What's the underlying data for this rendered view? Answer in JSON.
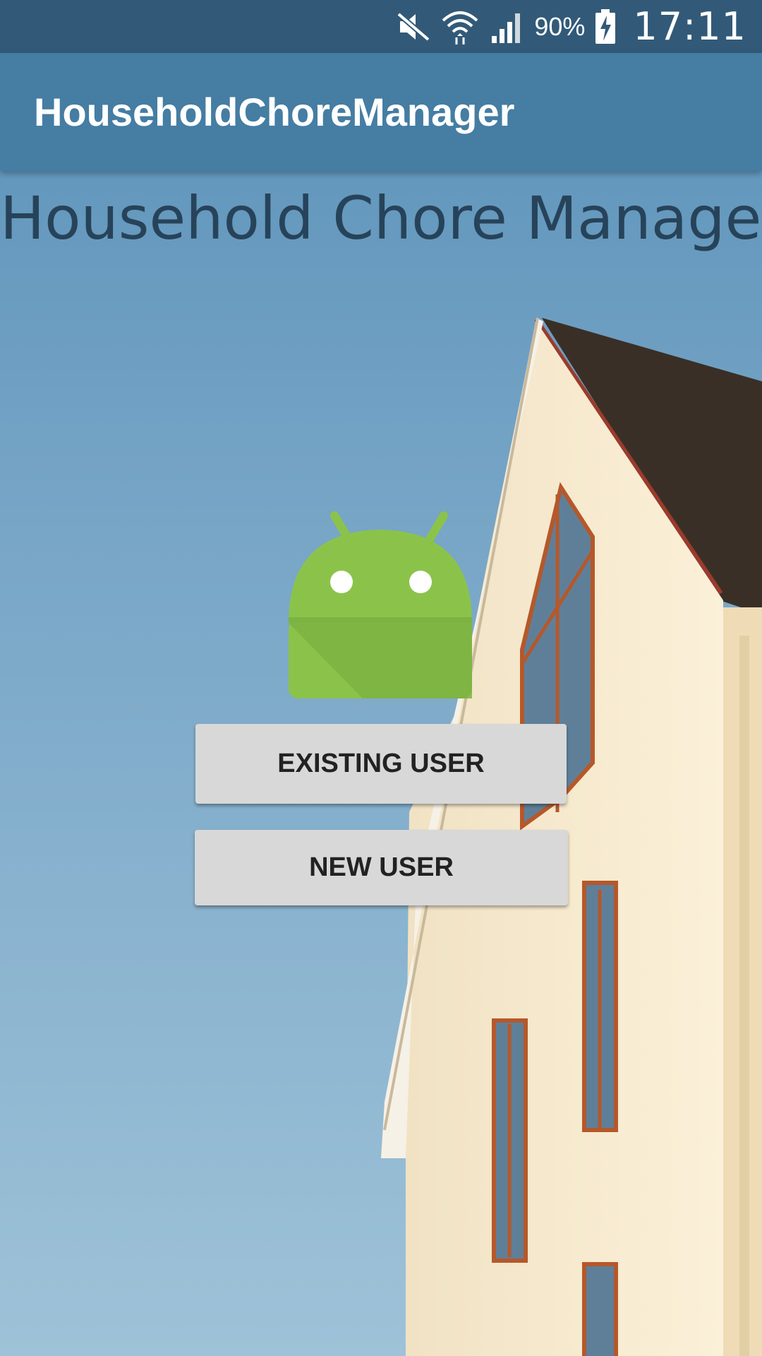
{
  "status_bar": {
    "battery_percent": "90%",
    "time": "17:11",
    "icons": [
      "mute-icon",
      "wifi-icon",
      "signal-icon",
      "battery-charging-icon"
    ]
  },
  "app_bar": {
    "title": "HouseholdChoreManager"
  },
  "main": {
    "heading": "Household Chore Manager",
    "logo_icon": "android-robot-icon",
    "existing_user_label": "EXISTING USER",
    "new_user_label": "NEW USER"
  },
  "colors": {
    "status_bar": "#325a78",
    "app_bar": "#457da3",
    "heading_text": "#27435a",
    "button_bg": "#d8d8d8",
    "android_green": "#8bc34a"
  }
}
